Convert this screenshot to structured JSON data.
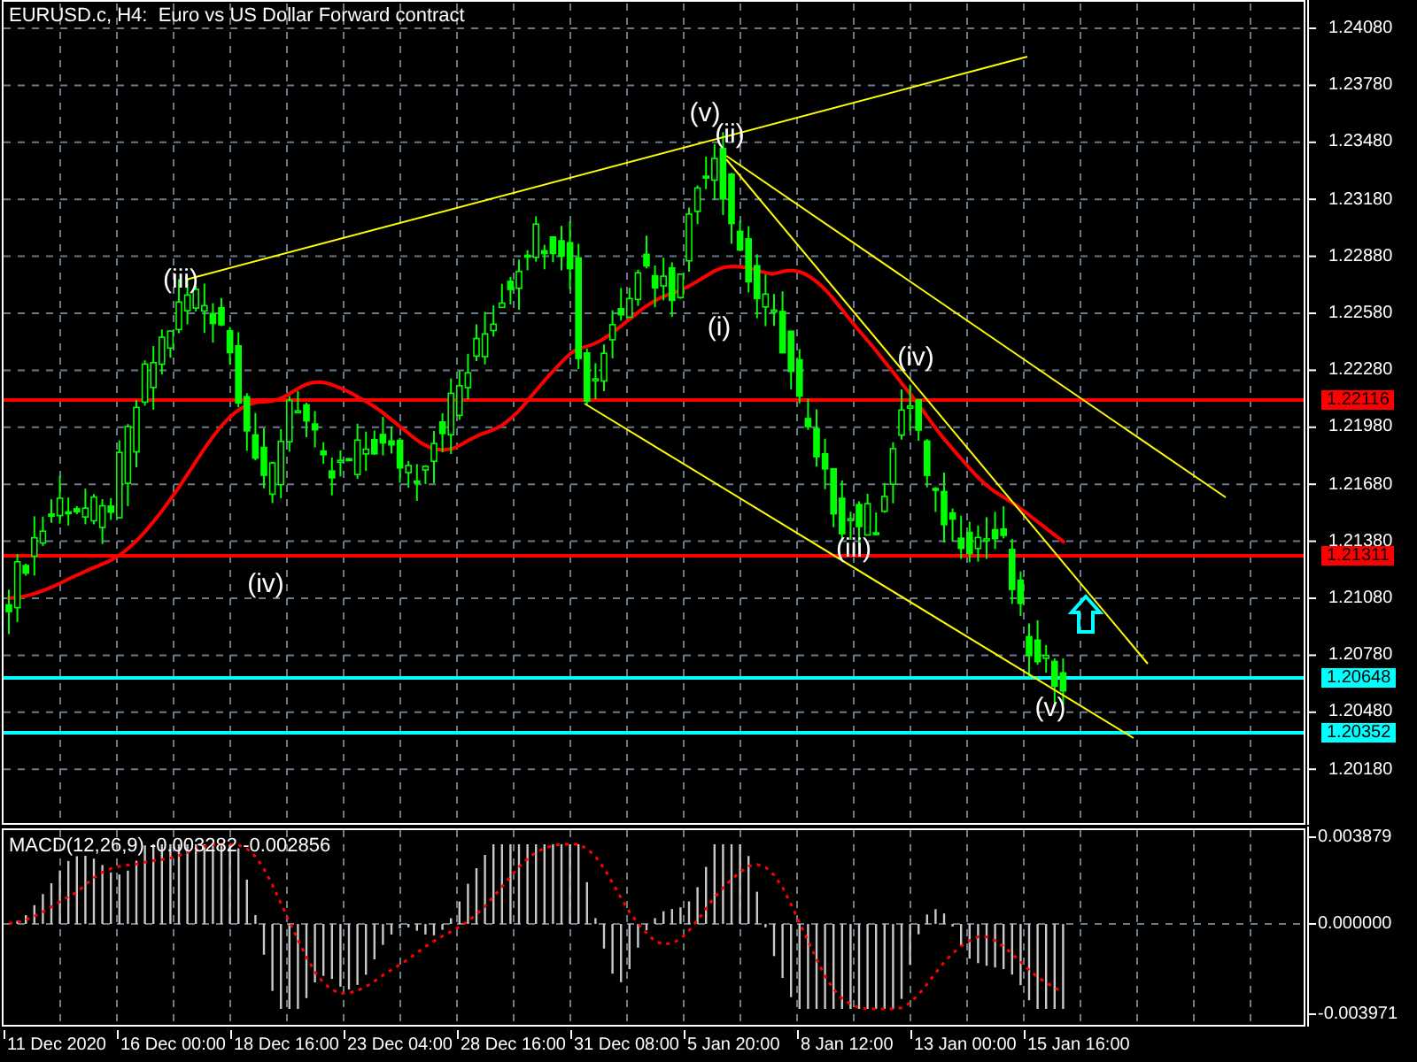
{
  "window": {
    "title": "EURUSD.c, H4:  Euro vs US Dollar Forward contract"
  },
  "price_axis": {
    "labels": [
      "1.24080",
      "1.23780",
      "1.23480",
      "1.23180",
      "1.22880",
      "1.22580",
      "1.22280",
      "1.21980",
      "1.21680",
      "1.21380",
      "1.21080",
      "1.20780",
      "1.20480",
      "1.20180"
    ]
  },
  "levels": [
    {
      "price": "1.22116",
      "color": "#ff0000"
    },
    {
      "price": "1.21311",
      "color": "#ff0000"
    },
    {
      "price": "1.20648",
      "color": "#00ffff"
    },
    {
      "price": "1.20352",
      "color": "#00ffff"
    }
  ],
  "wave_labels": [
    "(v)",
    "(ii)",
    "(iii)",
    "(i)",
    "(iv)",
    "(iv)",
    "(iii)",
    "(v)"
  ],
  "macd": {
    "title": "MACD(12,26,9) -0.003282 -0.002856",
    "axis_labels": [
      "0.003879",
      "0.000000",
      "-0.003971"
    ]
  },
  "time_axis": {
    "labels": [
      "11 Dec 2020",
      "16 Dec 00:00",
      "18 Dec 16:00",
      "23 Dec 04:00",
      "28 Dec 16:00",
      "31 Dec 08:00",
      "5 Jan 20:00",
      "8 Jan 12:00",
      "13 Jan 00:00",
      "15 Jan 16:00"
    ]
  }
}
